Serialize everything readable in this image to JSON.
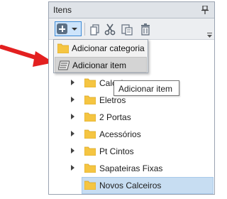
{
  "panel": {
    "title": "Itens",
    "pin_icon": "pin-icon"
  },
  "toolbar": {
    "add_icon": "add-icon",
    "buttons": [
      "copy-icon",
      "cut-icon",
      "paste-icon",
      "delete-icon"
    ]
  },
  "dropdown": {
    "items": [
      {
        "label": "Adicionar categoria",
        "icon": "folder-icon"
      },
      {
        "label": "Adicionar item",
        "icon": "item-icon"
      }
    ]
  },
  "tooltip": {
    "text": "Adicionar item"
  },
  "tree": {
    "nodes": [
      {
        "label": "Calceiros",
        "expandable": true
      },
      {
        "label": "Eletros",
        "expandable": true
      },
      {
        "label": "2 Portas",
        "expandable": true
      },
      {
        "label": "Acessórios",
        "expandable": true
      },
      {
        "label": "Pt Cintos",
        "expandable": true
      },
      {
        "label": "Sapateiras Fixas",
        "expandable": true
      }
    ],
    "selected_label": "Novos Calceiros"
  },
  "colors": {
    "folder": "#f5c542",
    "selection": "#c7ddf2",
    "arrow": "#e32020",
    "toolbar_highlight": "#cde4fb"
  }
}
